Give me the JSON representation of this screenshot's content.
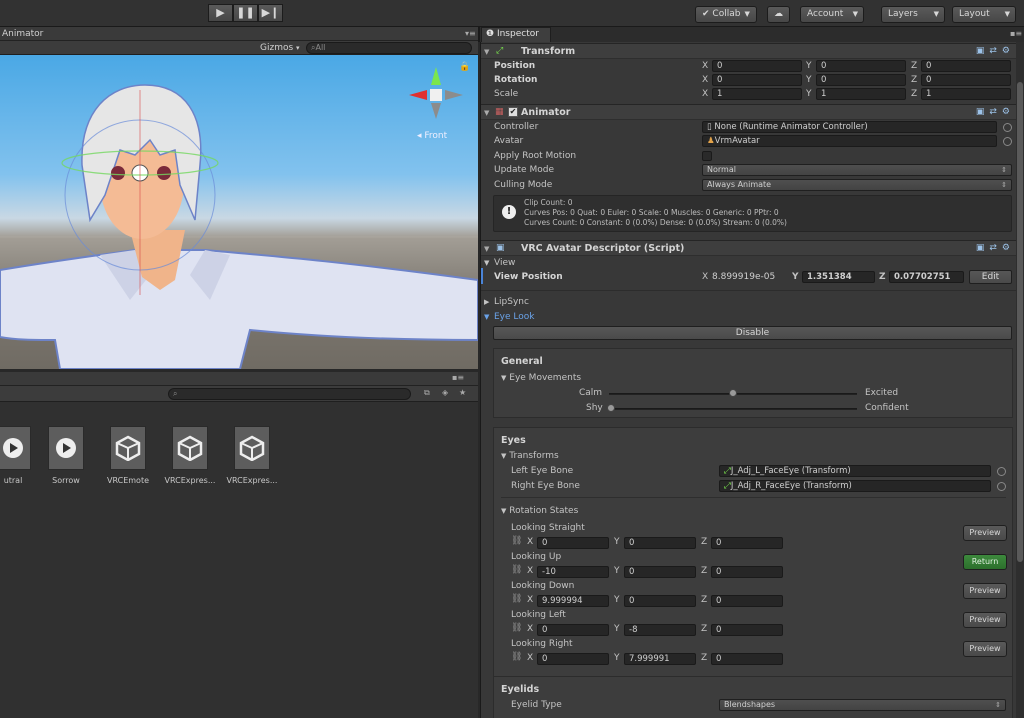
{
  "toolbar": {
    "play_icon": "play-icon",
    "pause_icon": "pause-icon",
    "step_icon": "step-icon",
    "collab": "Collab",
    "cloud_icon": "cloud-icon",
    "account": "Account",
    "layers": "Layers",
    "layout": "Layout"
  },
  "scene": {
    "tab": "Animator",
    "gizmos": "Gizmos",
    "search_placeholder": "All",
    "gizmo_label": "Front"
  },
  "project": {
    "assets": [
      {
        "label": "utral",
        "icon": "play-icon"
      },
      {
        "label": "Sorrow",
        "icon": "play-icon"
      },
      {
        "label": "VRCEmote",
        "icon": "unity-icon"
      },
      {
        "label": "VRCExpres...",
        "icon": "unity-icon"
      },
      {
        "label": "VRCExpres...",
        "icon": "unity-icon"
      }
    ]
  },
  "inspector": {
    "tab": "Inspector",
    "transform": {
      "title": "Transform",
      "position_label": "Position",
      "rotation_label": "Rotation",
      "scale_label": "Scale",
      "position": {
        "x": "0",
        "y": "0",
        "z": "0"
      },
      "rotation": {
        "x": "0",
        "y": "0",
        "z": "0"
      },
      "scale": {
        "x": "1",
        "y": "1",
        "z": "1"
      }
    },
    "animator": {
      "title": "Animator",
      "controller_label": "Controller",
      "controller_value": "None (Runtime Animator Controller)",
      "avatar_label": "Avatar",
      "avatar_value": "VrmAvatar",
      "apply_root_motion_label": "Apply Root Motion",
      "update_mode_label": "Update Mode",
      "update_mode_value": "Normal",
      "culling_mode_label": "Culling Mode",
      "culling_mode_value": "Always Animate",
      "info_line1": "Clip Count: 0",
      "info_line2": "Curves Pos: 0 Quat: 0 Euler: 0 Scale: 0 Muscles: 0 Generic: 0 PPtr: 0",
      "info_line3": "Curves Count: 0 Constant: 0 (0.0%) Dense: 0 (0.0%) Stream: 0 (0.0%)"
    },
    "descriptor": {
      "title": "VRC Avatar Descriptor (Script)",
      "view_foldout": "View",
      "view_position_label": "View Position",
      "view_x": "8.899919e-05",
      "view_y": "1.351384",
      "view_z": "0.07702751",
      "edit_button": "Edit",
      "lipsync_foldout": "LipSync",
      "eyelook_foldout": "Eye Look",
      "disable_button": "Disable",
      "general_heading": "General",
      "eye_movements_foldout": "Eye Movements",
      "calm_label": "Calm",
      "excited_label": "Excited",
      "calm_excited_value": 0.5,
      "shy_label": "Shy",
      "confident_label": "Confident",
      "shy_confident_value": 0.0,
      "eyes_heading": "Eyes",
      "transforms_foldout": "Transforms",
      "left_eye_label": "Left Eye Bone",
      "left_eye_value": "J_Adj_L_FaceEye (Transform)",
      "right_eye_label": "Right Eye Bone",
      "right_eye_value": "J_Adj_R_FaceEye (Transform)",
      "rotation_states_foldout": "Rotation States",
      "states": [
        {
          "label": "Looking Straight",
          "x": "0",
          "y": "0",
          "z": "0",
          "button": "Preview"
        },
        {
          "label": "Looking Up",
          "x": "-10",
          "y": "0",
          "z": "0",
          "button": "Return"
        },
        {
          "label": "Looking Down",
          "x": "9.999994",
          "y": "0",
          "z": "0",
          "button": "Preview"
        },
        {
          "label": "Looking Left",
          "x": "0",
          "y": "-8",
          "z": "0",
          "button": "Preview"
        },
        {
          "label": "Looking Right",
          "x": "0",
          "y": "7.999991",
          "z": "0",
          "button": "Preview"
        }
      ],
      "eyelids_heading": "Eyelids",
      "eyelid_type_label": "Eyelid Type",
      "eyelid_type_value": "Blendshapes"
    },
    "axis": {
      "x": "X",
      "y": "Y",
      "z": "Z"
    }
  }
}
